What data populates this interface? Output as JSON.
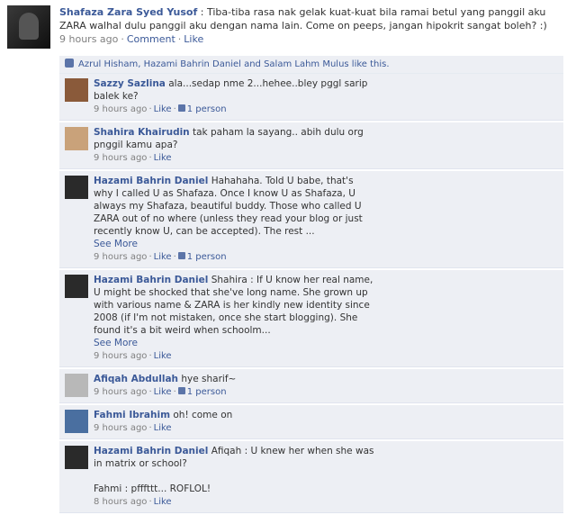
{
  "post": {
    "author": "Shafaza Zara Syed Yusof",
    "text": "Tiba-tiba rasa nak gelak kuat-kuat bila ramai betul yang panggil aku ZARA walhal dulu panggil aku dengan nama lain. Come on peeps, jangan hipokrit sangat boleh? :)",
    "time": "9 hours ago",
    "sep": "·",
    "comment_label": "Comment",
    "like_label": "Like"
  },
  "likes_text": "Azrul Hisham, Hazami Bahrin Daniel and Salam Lahm Mulus like this.",
  "comments": [
    {
      "name": "Sazzy Sazlina",
      "text": "ala...sedap nme 2...hehee..bley pggl sarip balek ke?",
      "time": "9 hours ago",
      "like": "Like",
      "likes": "1 person",
      "avatar_color": "#8a5a3a"
    },
    {
      "name": "Shahira Khairudin",
      "text": "tak paham la sayang.. abih dulu org pnggil kamu apa?",
      "time": "9 hours ago",
      "like": "Like",
      "avatar_color": "#c9a27a"
    },
    {
      "name": "Hazami Bahrin Daniel",
      "text": "Hahahaha. Told U babe, that's why I called U as Shafaza. Once I know U as Shafaza, U always my Shafaza, beautiful buddy. Those who called U ZARA out of no where (unless they read your blog or just recently know U, can be accepted). The rest ...",
      "see_more": "See More",
      "time": "9 hours ago",
      "like": "Like",
      "likes": "1 person",
      "avatar_color": "#2a2a2a"
    },
    {
      "name": "Hazami Bahrin Daniel",
      "text": "Shahira : If U know her real name, U might be shocked that she've long name. She grown up with various name & ZARA is her kindly new identity since 2008 (if I'm not mistaken, once she start blogging). She found it's a bit weird when schoolm...",
      "see_more": "See More",
      "time": "9 hours ago",
      "like": "Like",
      "avatar_color": "#2a2a2a"
    },
    {
      "name": "Afiqah Abdullah",
      "text": "hye sharif~",
      "time": "9 hours ago",
      "like": "Like",
      "likes": "1 person",
      "avatar_color": "#b8b8b8"
    },
    {
      "name": "Fahmi Ibrahim",
      "text": "oh! come on",
      "time": "9 hours ago",
      "like": "Like",
      "avatar_color": "#4a6fa0"
    },
    {
      "name": "Hazami Bahrin Daniel",
      "text": "Afiqah : U knew her when she was in matrix or school?",
      "text2": "Fahmi : pfffttt... ROFLOL!",
      "time": "8 hours ago",
      "like": "Like",
      "avatar_color": "#2a2a2a"
    }
  ]
}
